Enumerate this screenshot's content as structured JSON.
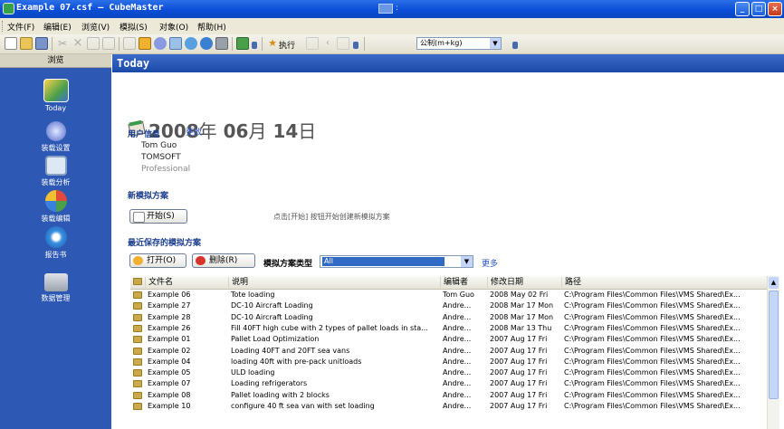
{
  "window": {
    "title": "Example 07.csf – CubeMaster",
    "ime_label": ":"
  },
  "menu": [
    "文件(F)",
    "编辑(E)",
    "浏览(V)",
    "模拟(S)",
    "对象(O)",
    "帮助(H)"
  ],
  "toolbar": {
    "run_label": "执行",
    "unit_combo": "公制(m+kg)"
  },
  "sidebar": {
    "header": "浏览",
    "items": [
      {
        "label": "Today"
      },
      {
        "label": "装载设置"
      },
      {
        "label": "装载分析"
      },
      {
        "label": "装载编辑"
      },
      {
        "label": "报告书"
      },
      {
        "label": "数据管理"
      }
    ]
  },
  "main": {
    "header": "Today",
    "date": {
      "year": "2008",
      "year_unit": "年",
      "month": "06",
      "month_unit": "月",
      "day": "14",
      "day_unit": "日"
    },
    "user_info": {
      "title": "用户信息",
      "change_link": "更改",
      "name": "Tom Guo",
      "company": "TOMSOFT",
      "edition": "Professional"
    },
    "new_plan": {
      "title": "新模拟方案",
      "start_button": "开始(S)",
      "hint": "点击[开始] 按钮开始创建新模拟方案"
    },
    "recent": {
      "title": "最近保存的模拟方案",
      "open_button": "打开(O)",
      "delete_button": "删除(R)",
      "type_label": "模拟方案类型",
      "type_value": "All",
      "more_link": "更多",
      "columns": [
        "文件名",
        "说明",
        "编辑者",
        "修改日期",
        "路径"
      ],
      "rows": [
        [
          "Example 06",
          "Tote loading",
          "Tom Guo",
          "2008 May 02 Fri",
          "C:\\Program Files\\Common Files\\VMS Shared\\Ex..."
        ],
        [
          "Example 27",
          "DC-10 Aircraft Loading",
          "Andre...",
          "2008 Mar 17 Mon",
          "C:\\Program Files\\Common Files\\VMS Shared\\Ex..."
        ],
        [
          "Example 28",
          "DC-10 Aircraft Loading",
          "Andre...",
          "2008 Mar 17 Mon",
          "C:\\Program Files\\Common Files\\VMS Shared\\Ex..."
        ],
        [
          "Example 26",
          "Fill 40FT high cube with 2 types of pallet loads in sta...",
          "Andre...",
          "2008 Mar 13 Thu",
          "C:\\Program Files\\Common Files\\VMS Shared\\Ex..."
        ],
        [
          "Example 01",
          "Pallet Load Optimization",
          "Andre...",
          "2007 Aug 17 Fri",
          "C:\\Program Files\\Common Files\\VMS Shared\\Ex..."
        ],
        [
          "Example 02",
          "Loading 40FT and 20FT sea vans",
          "Andre...",
          "2007 Aug 17 Fri",
          "C:\\Program Files\\Common Files\\VMS Shared\\Ex..."
        ],
        [
          "Example 04",
          "loading 40ft with pre-pack unitloads",
          "Andre...",
          "2007 Aug 17 Fri",
          "C:\\Program Files\\Common Files\\VMS Shared\\Ex..."
        ],
        [
          "Example 05",
          "ULD loading",
          "Andre...",
          "2007 Aug 17 Fri",
          "C:\\Program Files\\Common Files\\VMS Shared\\Ex..."
        ],
        [
          "Example 07",
          "Loading refrigerators",
          "Andre...",
          "2007 Aug 17 Fri",
          "C:\\Program Files\\Common Files\\VMS Shared\\Ex..."
        ],
        [
          "Example 08",
          "Pallet loading with 2 blocks",
          "Andre...",
          "2007 Aug 17 Fri",
          "C:\\Program Files\\Common Files\\VMS Shared\\Ex..."
        ],
        [
          "Example 10",
          "configure 40 ft sea van with set loading",
          "Andre...",
          "2007 Aug 17 Fri",
          "C:\\Program Files\\Common Files\\VMS Shared\\Ex..."
        ]
      ]
    }
  },
  "colors": {
    "title_bar": "#0a4fd6",
    "sidebar": "#2d58b4",
    "section_title": "#1a3d8c",
    "link": "#2a55c8",
    "selection": "#316ac5"
  }
}
